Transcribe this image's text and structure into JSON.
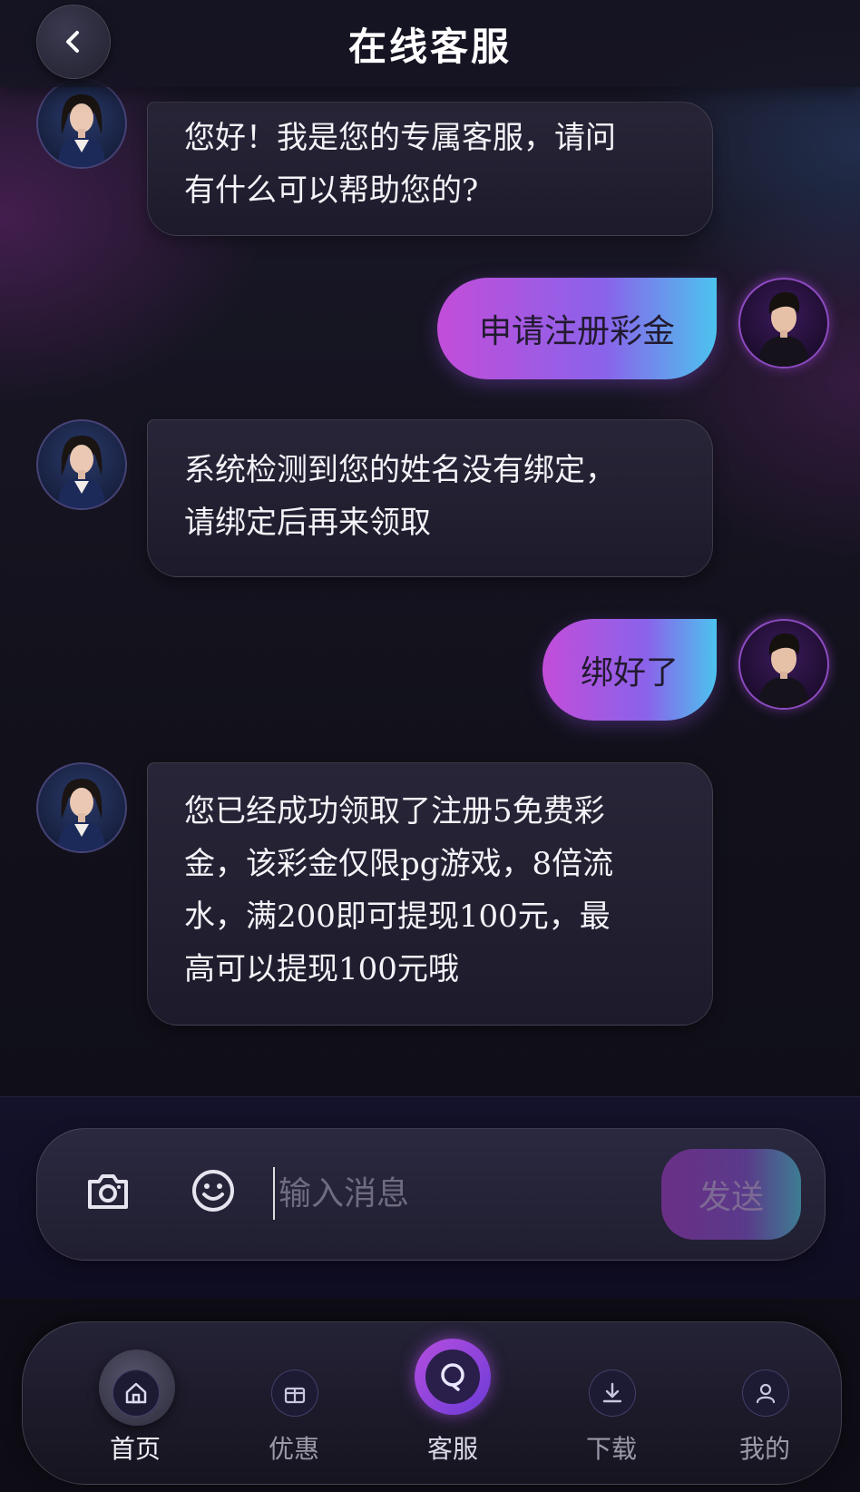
{
  "header": {
    "title": "在线客服"
  },
  "messages": [
    {
      "from": "agent",
      "text": "您好！我是您的专属客服，请问\n有什么可以帮助您的?"
    },
    {
      "from": "user",
      "text": "申请注册彩金"
    },
    {
      "from": "agent",
      "text": "系统检测到您的姓名没有绑定，\n请绑定后再来领取"
    },
    {
      "from": "user",
      "text": "绑好了"
    },
    {
      "from": "agent",
      "text": "您已经成功领取了注册5免费彩\n金，该彩金仅限pg游戏，8倍流\n水，满200即可提现100元，最\n高可以提现100元哦"
    }
  ],
  "composer": {
    "placeholder": "输入消息",
    "value": "",
    "send_label": "发送"
  },
  "tabs": [
    {
      "label": "首页",
      "icon": "home-icon",
      "active": true
    },
    {
      "label": "优惠",
      "icon": "gift-icon",
      "active": false
    },
    {
      "label": "客服",
      "icon": "customer-service-icon",
      "active": false
    },
    {
      "label": "下载",
      "icon": "download-icon",
      "active": false
    },
    {
      "label": "我的",
      "icon": "user-icon",
      "active": false
    }
  ],
  "colors": {
    "user_bubble_gradient": [
      "#c24dd9",
      "#8a63ea",
      "#4cc3ee"
    ],
    "agent_bubble": "#242235",
    "background": "#12111b"
  }
}
